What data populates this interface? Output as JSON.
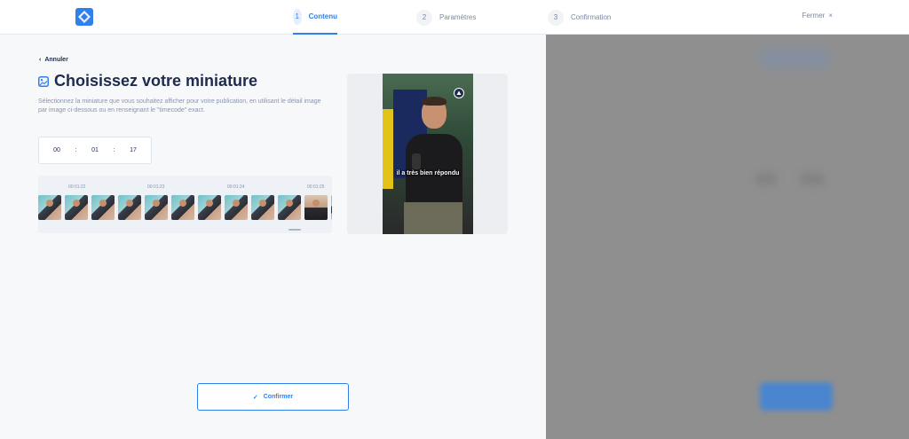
{
  "header": {
    "steps": [
      {
        "num": "1",
        "label": "Contenu",
        "active": true
      },
      {
        "num": "2",
        "label": "Paramètres",
        "active": false
      },
      {
        "num": "3",
        "label": "Confirmation",
        "active": false
      }
    ],
    "close_label": "Fermer",
    "close_icon": "×"
  },
  "main": {
    "back_label": "Annuler",
    "title": "Choisissez votre miniature",
    "description": "Sélectionnez la miniature que vous souhaitez afficher pour votre publication, en utilisant le détail image par image ci-dessous ou en renseignant le \"timecode\" exact.",
    "timecode": {
      "hours": "00",
      "minutes": "01",
      "seconds": "17",
      "separator": ":"
    },
    "timeline_ticks": [
      "00:01:22",
      "00:01:23",
      "00:01:24",
      "00:01:25"
    ],
    "video_caption": "il a très bien répondu",
    "confirm_label": "Confirmer",
    "confirm_icon": "✓"
  },
  "colors": {
    "accent": "#2f80ed",
    "text": "#1d2b4f",
    "muted": "#8a94ad",
    "overlay": "#8f8f8f"
  }
}
